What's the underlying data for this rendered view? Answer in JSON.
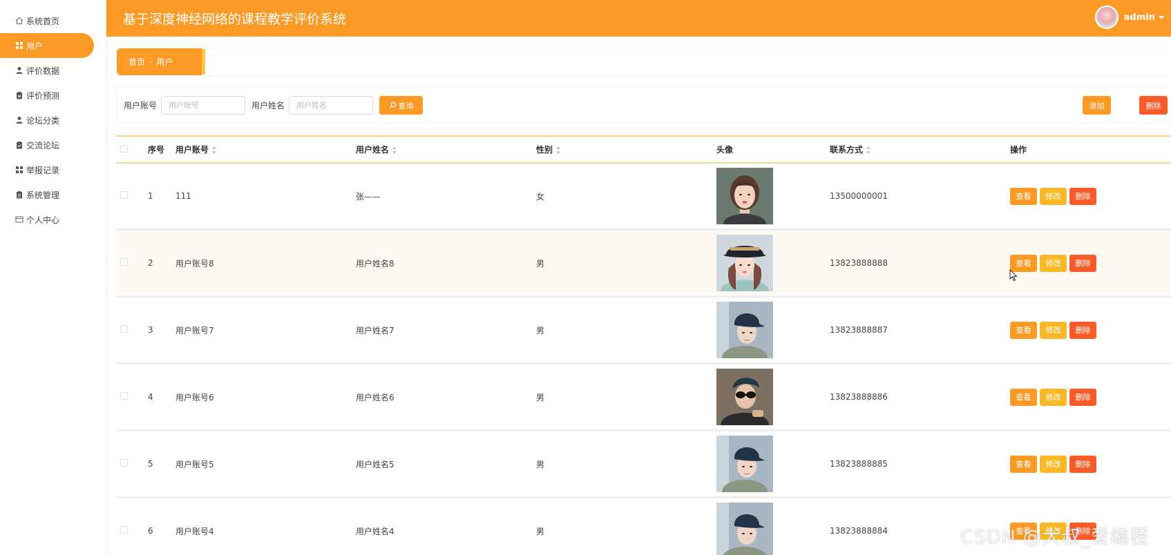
{
  "app": {
    "title": "基于深度神经网络的课程教学评价系统",
    "user": "admin"
  },
  "sidebar": {
    "items": [
      {
        "label": "系统首页",
        "icon": "home-icon",
        "active": false
      },
      {
        "label": "用户",
        "icon": "grid-icon",
        "active": true
      },
      {
        "label": "评价数据",
        "icon": "person-icon",
        "active": false
      },
      {
        "label": "评价预测",
        "icon": "clipboard-icon",
        "active": false
      },
      {
        "label": "论坛分类",
        "icon": "person-icon",
        "active": false
      },
      {
        "label": "交流论坛",
        "icon": "clipboard-check-icon",
        "active": false
      },
      {
        "label": "举报记录",
        "icon": "grid-icon",
        "active": false
      },
      {
        "label": "系统管理",
        "icon": "clipboard-icon",
        "active": false
      },
      {
        "label": "个人中心",
        "icon": "card-icon",
        "active": false
      }
    ]
  },
  "breadcrumb": {
    "home": "首页",
    "separator": "-",
    "current": "用户"
  },
  "search": {
    "account_label": "用户账号",
    "account_placeholder": "用户账号",
    "name_label": "用户姓名",
    "name_placeholder": "用户姓名",
    "search_button": "查询",
    "add_button": "添加",
    "delete_button": "删除"
  },
  "table": {
    "headers": {
      "no": "序号",
      "account": "用户账号",
      "name": "用户姓名",
      "gender": "性别",
      "avatar": "头像",
      "phone": "联系方式",
      "actions": "操作"
    },
    "actions": {
      "view": "查看",
      "edit": "修改",
      "delete": "删除"
    },
    "rows": [
      {
        "no": "1",
        "account": "111",
        "name": "张——",
        "gender": "女",
        "phone": "13500000001",
        "photo": "woman-short-hair"
      },
      {
        "no": "2",
        "account": "用户账号8",
        "name": "用户姓名8",
        "gender": "男",
        "phone": "13823888888",
        "photo": "woman-hat"
      },
      {
        "no": "3",
        "account": "用户账号7",
        "name": "用户姓名7",
        "gender": "男",
        "phone": "13823888887",
        "photo": "man-cap"
      },
      {
        "no": "4",
        "account": "用户账号6",
        "name": "用户姓名6",
        "gender": "男",
        "phone": "13823888886",
        "photo": "man-sunglasses"
      },
      {
        "no": "5",
        "account": "用户账号5",
        "name": "用户姓名5",
        "gender": "男",
        "phone": "13823888885",
        "photo": "man-cap"
      },
      {
        "no": "6",
        "account": "用户账号4",
        "name": "用户姓名4",
        "gender": "男",
        "phone": "13823888884",
        "photo": "man-cap"
      }
    ]
  },
  "watermark": "CSDN @大叔_爱编程",
  "colors": {
    "primary": "#fd9a26",
    "warning": "#fbb928",
    "danger": "#fb5b29"
  }
}
